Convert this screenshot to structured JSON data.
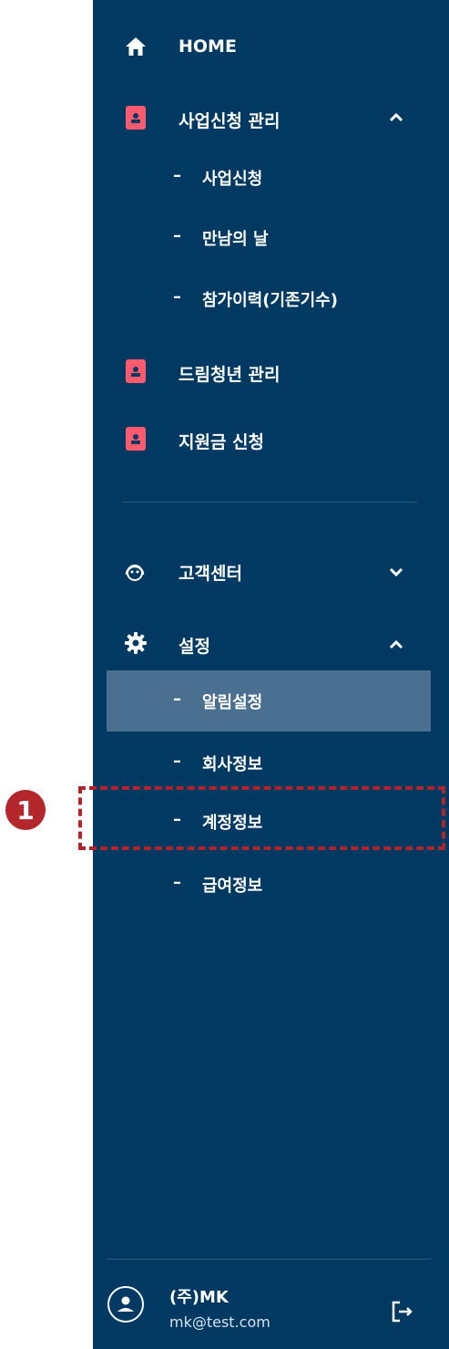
{
  "menu": {
    "home": "HOME",
    "business": {
      "label": "사업신청 관리",
      "items": [
        "사업신청",
        "만남의 날",
        "참가이력(기존기수)"
      ]
    },
    "dream": "드림청년 관리",
    "support": "지원금 신청",
    "customer": "고객센터",
    "settings": {
      "label": "설정",
      "items": [
        "알림설정",
        "회사정보",
        "계정정보",
        "급여정보"
      ]
    }
  },
  "dash": "–",
  "callout_number": "1",
  "user": {
    "name": "(주)MK",
    "email": "mk@test.com"
  },
  "colors": {
    "sidebar": "#003a63",
    "active": "#4a6f8f",
    "doc_icon": "#ff5a6e",
    "highlight": "#b3232a"
  }
}
